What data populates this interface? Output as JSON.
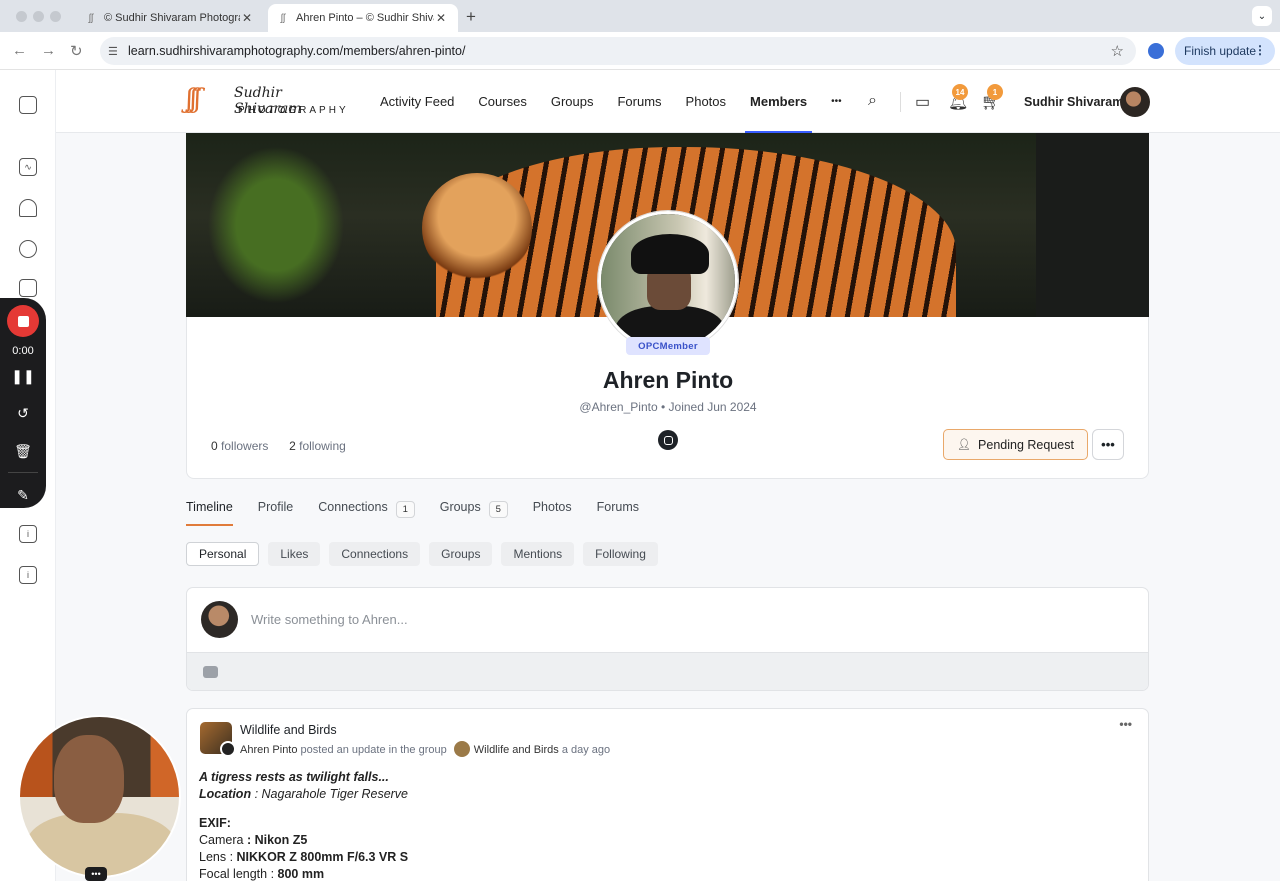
{
  "browser": {
    "tabs": [
      {
        "title": "© Sudhir Shivaram Photograp",
        "active": false
      },
      {
        "title": "Ahren Pinto – © Sudhir Shiva",
        "active": true
      }
    ],
    "url": "learn.sudhirshivaramphotography.com/members/ahren-pinto/",
    "finish_update_label": "Finish update"
  },
  "recorder": {
    "time": "0:00"
  },
  "site": {
    "logo_script": "Sudhir Shivaram",
    "logo_sub": "PHOTOGRAPHY",
    "nav": [
      "Activity Feed",
      "Courses",
      "Groups",
      "Forums",
      "Photos",
      "Members"
    ],
    "active_nav": "Members",
    "more": "•••",
    "notifications_count": "14",
    "cart_count": "1",
    "user_name": "Sudhir Shivaram"
  },
  "profile": {
    "member_type": "OPCMember",
    "name": "Ahren Pinto",
    "handle": "@Ahren_Pinto",
    "joined": "Joined Jun 2024",
    "followers_count": "0",
    "followers_label": "followers",
    "following_count": "2",
    "following_label": "following",
    "pending_label": "Pending Request"
  },
  "tabs": [
    {
      "label": "Timeline",
      "count": null,
      "active": true
    },
    {
      "label": "Profile",
      "count": null
    },
    {
      "label": "Connections",
      "count": "1"
    },
    {
      "label": "Groups",
      "count": "5"
    },
    {
      "label": "Photos",
      "count": null
    },
    {
      "label": "Forums",
      "count": null
    }
  ],
  "subtabs": [
    "Personal",
    "Likes",
    "Connections",
    "Groups",
    "Mentions",
    "Following"
  ],
  "composer": {
    "placeholder": "Write something to Ahren..."
  },
  "post": {
    "group": "Wildlife and Birds",
    "author": "Ahren Pinto",
    "action": "posted an update in the group",
    "group_link": "Wildlife and Birds",
    "time": "a day ago",
    "caption": "A tigress rests as twilight falls...",
    "location_label": "Location",
    "location_value": "Nagarahole Tiger Reserve",
    "exif_label": "EXIF:",
    "camera_label": "Camera",
    "camera_value": "Nikon Z5",
    "lens_label": "Lens",
    "lens_value": "NIKKOR Z 800mm F/6.3 VR S",
    "focal_label": "Focal length",
    "focal_value": "800 mm"
  }
}
